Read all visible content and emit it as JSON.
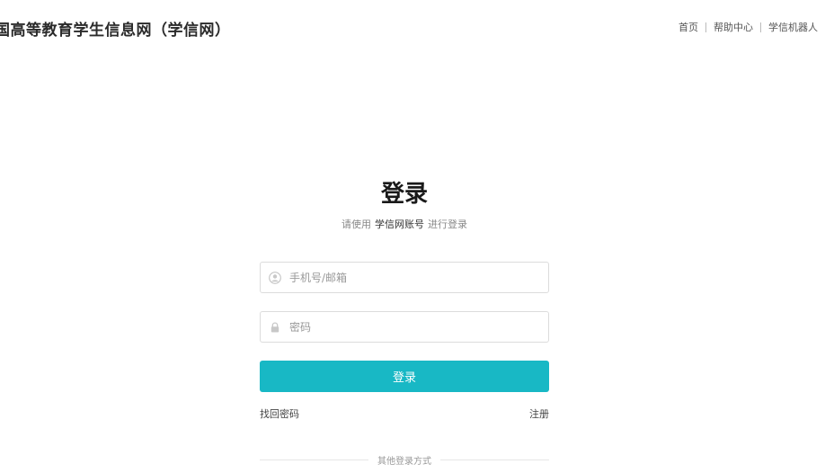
{
  "header": {
    "site_title": "国高等教育学生信息网（学信网）",
    "nav": [
      {
        "label": "首页"
      },
      {
        "label": "帮助中心"
      },
      {
        "label": "学信机器人"
      }
    ]
  },
  "login": {
    "title": "登录",
    "subtitle_prefix": "请使用",
    "subtitle_account": "学信网账号",
    "subtitle_suffix": "进行登录",
    "username_placeholder": "手机号/邮箱",
    "password_placeholder": "密码",
    "submit_label": "登录",
    "forgot_label": "找回密码",
    "register_label": "注册",
    "other_methods_label": "其他登录方式",
    "accent_color": "#18b8c5"
  },
  "icons": {
    "username": "user-circle-icon",
    "password": "lock-icon"
  }
}
